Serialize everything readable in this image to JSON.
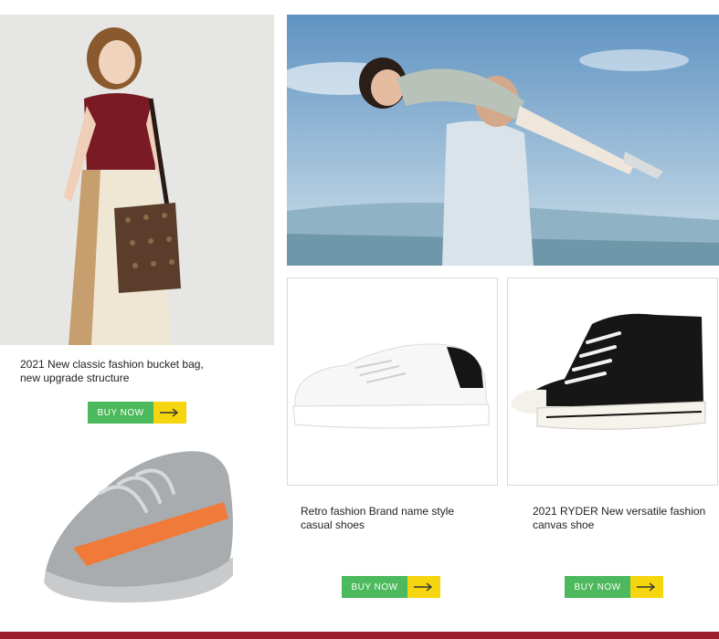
{
  "colors": {
    "buy_green": "#4cb95c",
    "buy_yellow": "#f5d60e",
    "footer_bar": "#9b1c2a"
  },
  "products": [
    {
      "image": "woman-with-bucket-bag-photo",
      "description_line1": "2021 New classic fashion bucket bag,",
      "description_line2": "new upgrade structure",
      "button_label": "BUY NOW",
      "button_icon": "arrow-right-icon"
    },
    {
      "image": "white-sneaker-photo",
      "description_line1": "Retro fashion Brand name style",
      "description_line2": "casual shoes",
      "button_label": "BUY NOW",
      "button_icon": "arrow-right-icon"
    },
    {
      "image": "black-canvas-high-top-photo",
      "description_line1": "2021 RYDER New versatile fashion",
      "description_line2": "canvas shoe",
      "button_label": "BUY NOW",
      "button_icon": "arrow-right-icon"
    }
  ],
  "banner": {
    "image": "couple-by-convertible-photo"
  },
  "kids_shoe": {
    "image": "grey-orange-knit-sneaker-photo"
  }
}
